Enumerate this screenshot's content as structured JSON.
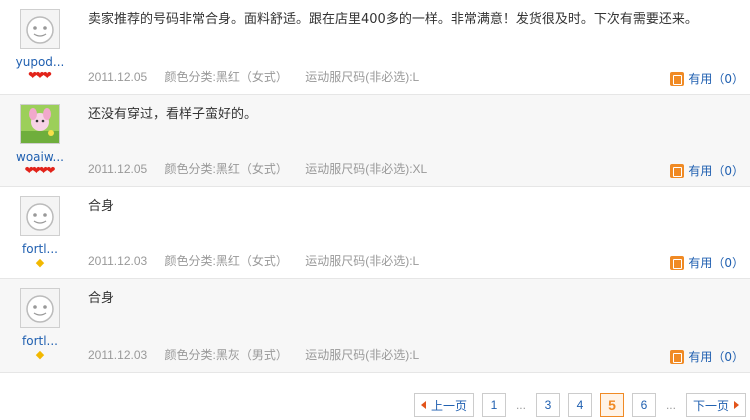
{
  "reviews": [
    {
      "username": "yupod...",
      "rank_icons": [
        "heart-icon",
        "heart-icon",
        "heart-icon"
      ],
      "content": "卖家推荐的号码非常合身。面料舒适。跟在店里400多的一样。非常满意！发货很及时。下次有需要还来。",
      "date": "2011.12.05",
      "color": "颜色分类:黑红（女式）",
      "size": "运动服尺码(非必选):L",
      "useful": "有用（0）"
    },
    {
      "username": "woaiw...",
      "rank_icons": [
        "heart-icon",
        "heart-icon",
        "heart-icon",
        "heart-icon"
      ],
      "content": "还没有穿过，看样子蛮好的。",
      "date": "2011.12.05",
      "color": "颜色分类:黑红（女式）",
      "size": "运动服尺码(非必选):XL",
      "useful": "有用（0）"
    },
    {
      "username": "fortl...",
      "rank_icons": [
        "diamond-icon"
      ],
      "content": "合身",
      "date": "2011.12.03",
      "color": "颜色分类:黑红（女式）",
      "size": "运动服尺码(非必选):L",
      "useful": "有用（0）"
    },
    {
      "username": "fortl...",
      "rank_icons": [
        "diamond-icon"
      ],
      "content": "合身",
      "date": "2011.12.03",
      "color": "颜色分类:黑灰（男式）",
      "size": "运动服尺码(非必选):L",
      "useful": "有用（0）"
    }
  ],
  "pagination": {
    "prev": "上一页",
    "next": "下一页",
    "pages": [
      "1",
      "...",
      "3",
      "4",
      "5",
      "6",
      "..."
    ],
    "current": "5"
  },
  "colors": {
    "link": "#1f5fb0",
    "accent": "#f08a24",
    "heart": "#e2231a",
    "diamond": "#f2b800"
  }
}
